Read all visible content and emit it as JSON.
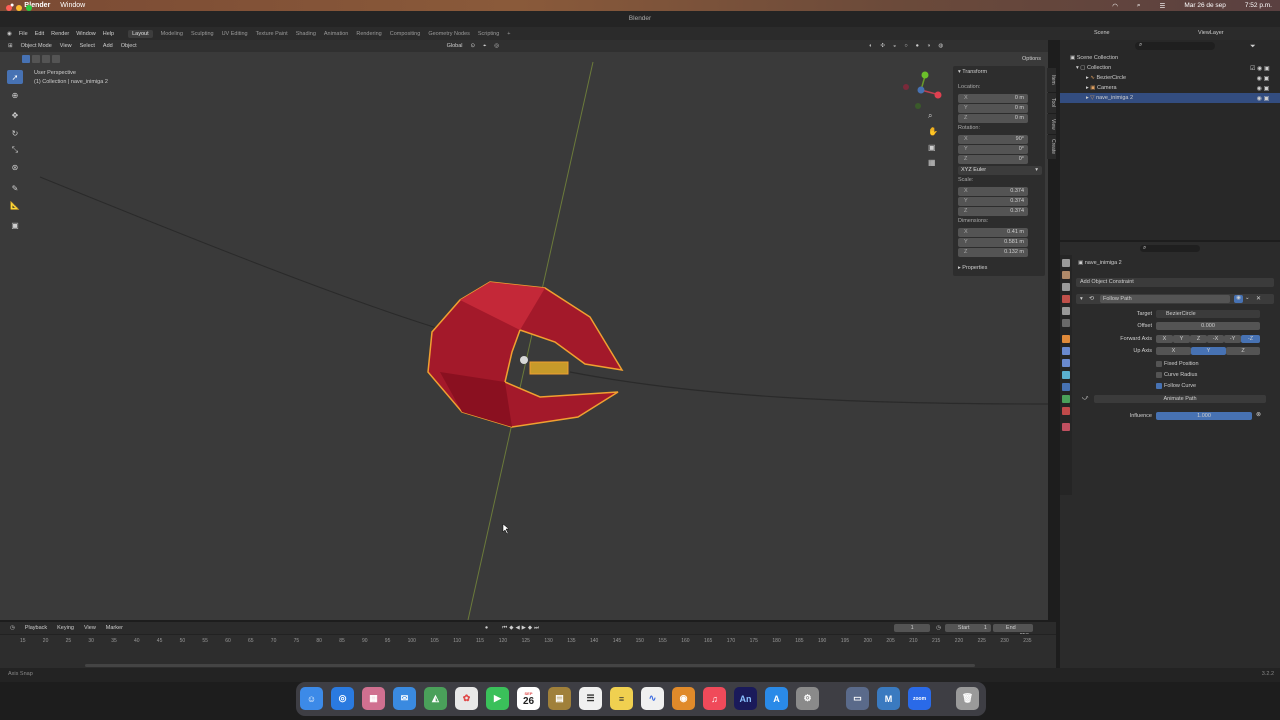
{
  "menubar": {
    "app": "Blender",
    "window": "Window",
    "date": "Mar 26 de sep",
    "time": "7:52 p.m."
  },
  "titlebar": {
    "title": "Blender"
  },
  "topbar": {
    "menus": [
      "File",
      "Edit",
      "Render",
      "Window",
      "Help"
    ],
    "workspaces": [
      "Layout",
      "Modeling",
      "Sculpting",
      "UV Editing",
      "Texture Paint",
      "Shading",
      "Animation",
      "Rendering",
      "Compositing",
      "Geometry Nodes",
      "Scripting"
    ],
    "active_workspace": "Layout",
    "scene": "Scene",
    "view_layer": "ViewLayer"
  },
  "viewport_header": {
    "mode": "Object Mode",
    "menus": [
      "View",
      "Select",
      "Add",
      "Object"
    ],
    "orientation": "Global",
    "options": "Options"
  },
  "viewport": {
    "perspective": "User Perspective",
    "collection_info": "(1) Collection | nave_inimiga 2"
  },
  "npanel": {
    "section": "Transform",
    "location_label": "Location:",
    "location": [
      "0 m",
      "0 m",
      "0 m"
    ],
    "rotation_label": "Rotation:",
    "rotation": [
      "90°",
      "0°",
      "0°"
    ],
    "rotation_mode": "XYZ Euler",
    "scale_label": "Scale:",
    "scale": [
      "0.374",
      "0.374",
      "0.374"
    ],
    "dimensions_label": "Dimensions:",
    "dimensions": [
      "0.41 m",
      "0.581 m",
      "0.132 m"
    ],
    "properties": "Properties",
    "axes": [
      "X",
      "Y",
      "Z"
    ],
    "tabs": [
      "Item",
      "Tool",
      "View",
      "Create"
    ]
  },
  "outliner": {
    "root": "Scene Collection",
    "items": [
      {
        "name": "Collection",
        "level": 1
      },
      {
        "name": "BezierCircle",
        "level": 2
      },
      {
        "name": "Camera",
        "level": 2
      },
      {
        "name": "nave_inimiga 2",
        "level": 2,
        "selected": true
      }
    ]
  },
  "properties": {
    "object_name": "nave_inimiga 2",
    "add_constraint": "Add Object Constraint",
    "constraint_name": "Follow Path",
    "target_label": "Target",
    "target_value": "BezierCircle",
    "offset_label": "Offset",
    "offset_value": "0.000",
    "forward_axis_label": "Forward Axis",
    "forward_axis_options": [
      "X",
      "Y",
      "Z",
      "-X",
      "-Y",
      "-Z"
    ],
    "forward_axis_selected": "-Z",
    "up_axis_label": "Up Axis",
    "up_axis_options": [
      "X",
      "Y",
      "Z"
    ],
    "up_axis_selected": "Y",
    "fixed_position": "Fixed Position",
    "curve_radius": "Curve Radius",
    "follow_curve": "Follow Curve",
    "animate_path": "Animate Path",
    "influence_label": "Influence",
    "influence_value": "1.000"
  },
  "timeline": {
    "menus": [
      "Playback",
      "Keying",
      "View",
      "Marker"
    ],
    "current_frame": "1",
    "start_label": "Start",
    "start": "1",
    "end_label": "End",
    "end": "250",
    "ticks": [
      "15",
      "20",
      "25",
      "30",
      "35",
      "40",
      "45",
      "50",
      "55",
      "60",
      "65",
      "70",
      "75",
      "80",
      "85",
      "90",
      "95",
      "100",
      "105",
      "110",
      "115",
      "120",
      "125",
      "130",
      "135",
      "140",
      "145",
      "150",
      "155",
      "160",
      "165",
      "170",
      "175",
      "180",
      "185",
      "190",
      "195",
      "200",
      "205",
      "210",
      "215",
      "220",
      "225",
      "230",
      "235"
    ]
  },
  "status": {
    "left": "Axis Snap",
    "version": "3.2.2"
  },
  "dock": {
    "calendar_day": "26",
    "calendar_month": "SEP",
    "an_label": "An",
    "m_label": "M",
    "zoom_label": "zoom"
  },
  "colors": {
    "accent": "#4772b3",
    "ship_red": "#b81f2f",
    "outline": "#f0a030",
    "viewport": "#3a3a3a"
  }
}
